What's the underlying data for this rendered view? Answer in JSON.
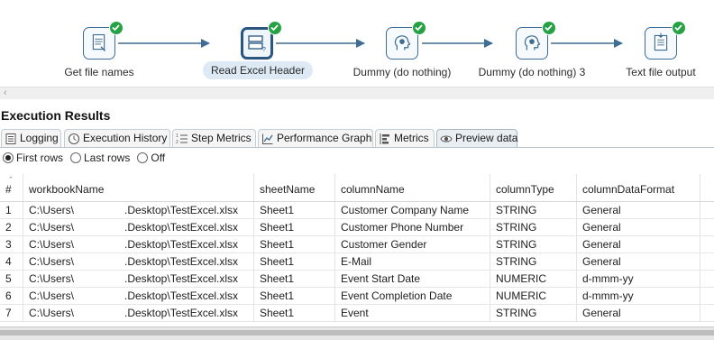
{
  "workflow": {
    "steps": [
      {
        "label": "Get file names",
        "icon": "file-list-icon",
        "status": "success"
      },
      {
        "label": "Read Excel Header",
        "icon": "excel-input-icon",
        "status": "success",
        "selected": true
      },
      {
        "label": "Dummy (do nothing)",
        "icon": "dummy-head-icon",
        "status": "success"
      },
      {
        "label": "Dummy (do nothing) 3",
        "icon": "dummy-head-icon",
        "status": "success"
      },
      {
        "label": "Text file output",
        "icon": "text-file-output-icon",
        "status": "success"
      }
    ],
    "colors": {
      "step_border": "#3d6c94",
      "arrow": "#3d6c94",
      "success": "#25a244"
    }
  },
  "results": {
    "title": "Execution Results",
    "tabs": [
      {
        "label": "Logging",
        "icon": "log-icon"
      },
      {
        "label": "Execution History",
        "icon": "clock-icon"
      },
      {
        "label": "Step Metrics",
        "icon": "list-numbered-icon"
      },
      {
        "label": "Performance Graph",
        "icon": "graph-icon"
      },
      {
        "label": "Metrics",
        "icon": "metrics-icon"
      },
      {
        "label": "Preview data",
        "icon": "eye-icon",
        "active": true
      }
    ],
    "radio": {
      "options": [
        "First rows",
        "Last rows",
        "Off"
      ],
      "selected": "First rows"
    },
    "table": {
      "columns": [
        "#",
        "workbookName",
        "sheetName",
        "columnName",
        "columnType",
        "columnDataFormat"
      ],
      "rows": [
        [
          "1",
          "C:\\Users\\",
          ".Desktop\\TestExcel.xlsx",
          "Sheet1",
          "Customer Company Name",
          "STRING",
          "General"
        ],
        [
          "2",
          "C:\\Users\\",
          ".Desktop\\TestExcel.xlsx",
          "Sheet1",
          "Customer Phone Number",
          "STRING",
          "General"
        ],
        [
          "3",
          "C:\\Users\\",
          ".Desktop\\TestExcel.xlsx",
          "Sheet1",
          "Customer Gender",
          "STRING",
          "General"
        ],
        [
          "4",
          "C:\\Users\\",
          ".Desktop\\TestExcel.xlsx",
          "Sheet1",
          "E-Mail",
          "STRING",
          "General"
        ],
        [
          "5",
          "C:\\Users\\",
          ".Desktop\\TestExcel.xlsx",
          "Sheet1",
          "Event Start Date",
          "NUMERIC",
          "d-mmm-yy"
        ],
        [
          "6",
          "C:\\Users\\",
          ".Desktop\\TestExcel.xlsx",
          "Sheet1",
          "Event Completion Date",
          "NUMERIC",
          "d-mmm-yy"
        ],
        [
          "7",
          "C:\\Users\\",
          ".Desktop\\TestExcel.xlsx",
          "Sheet1",
          "Event",
          "STRING",
          "General"
        ]
      ]
    }
  }
}
